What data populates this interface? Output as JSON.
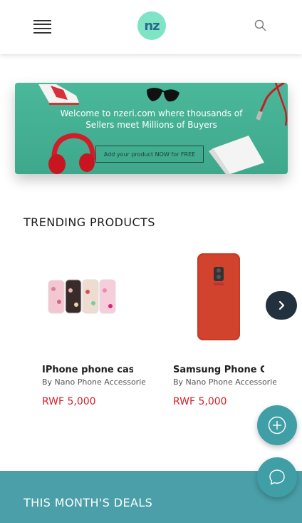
{
  "header": {
    "menu_icon": "hamburger-menu-icon",
    "logo_text": "nz",
    "search_icon": "search-icon"
  },
  "banner": {
    "line1": "Welcome to nzeri.com where thousands of",
    "line2": "Sellers meet Millions of Buyers",
    "cta": "Add your product NOW for FREE"
  },
  "trending": {
    "title": "TRENDING PRODUCTS",
    "products": [
      {
        "name": "IPhone phone case",
        "seller": "By Nano Phone Accessories",
        "price": "RWF 5,000"
      },
      {
        "name": "Samsung Phone Case",
        "seller": "By Nano Phone Accessories",
        "price": "RWF 5,000"
      }
    ],
    "next_icon": "chevron-right-icon"
  },
  "deals": {
    "title": "THIS MONTH'S DEALS"
  },
  "fabs": {
    "add_icon": "plus-circle-icon",
    "chat_icon": "chat-bubble-icon"
  },
  "colors": {
    "brand_teal": "#4a9fa8",
    "banner_green": "#4ab89a",
    "price_red": "#d4202a",
    "logo_mint": "#7fe3c6",
    "dark_button": "#22313d"
  }
}
